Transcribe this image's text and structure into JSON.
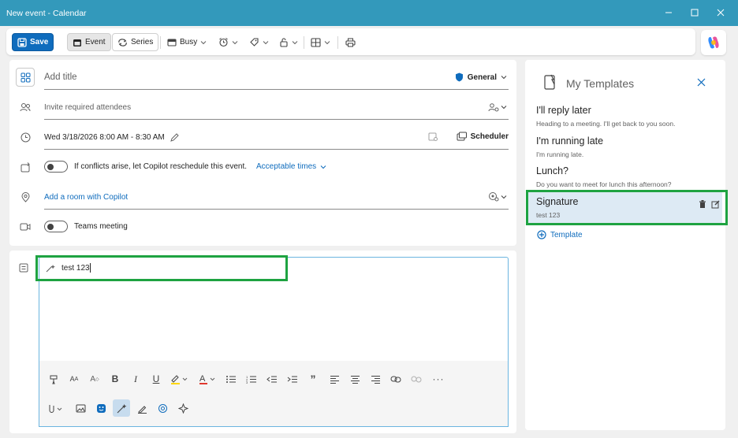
{
  "window": {
    "title": "New event - Calendar"
  },
  "toolbar": {
    "save": "Save",
    "event": "Event",
    "series": "Series",
    "busy": "Busy"
  },
  "form": {
    "title_placeholder": "Add title",
    "calendar": "General",
    "attendees_placeholder": "Invite required attendees",
    "datetime": "Wed 3/18/2026 8:00 AM - 8:30 AM",
    "scheduler": "Scheduler",
    "copilot_reschedule": "If conflicts arise, let Copilot reschedule this event.",
    "acceptable_times": "Acceptable times",
    "room": "Add a room with Copilot",
    "teams": "Teams meeting"
  },
  "editor": {
    "body_text": "test 123"
  },
  "templates": {
    "header": "My Templates",
    "items": [
      {
        "name": "I'll reply later",
        "desc": "Heading to a meeting. I'll get back to you soon."
      },
      {
        "name": "I'm running late",
        "desc": "I'm running late."
      },
      {
        "name": "Lunch?",
        "desc": "Do you want to meet for lunch this afternoon?"
      },
      {
        "name": "Signature",
        "desc": "test 123"
      }
    ],
    "add_label": "Template"
  },
  "colors": {
    "titlebar": "#3399bb",
    "accent": "#0f6cbd",
    "highlight": "#1ea341"
  }
}
